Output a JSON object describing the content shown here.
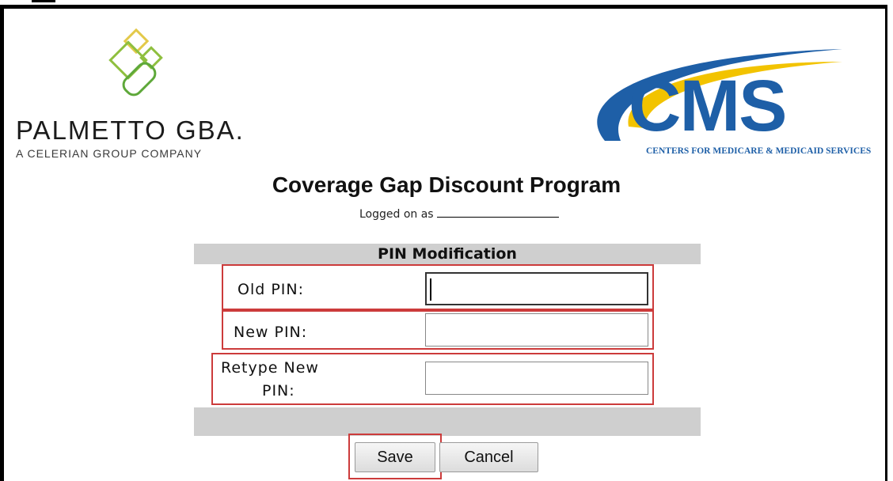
{
  "branding": {
    "palmetto_name": "PALMETTO GBA.",
    "palmetto_tagline": "A CELERIAN GROUP COMPANY",
    "cms_name": "CMS",
    "cms_tagline": "CENTERS FOR MEDICARE & MEDICAID SERVICES"
  },
  "page": {
    "title": "Coverage Gap Discount Program",
    "logged_on_label": "Logged on as"
  },
  "form": {
    "header": "PIN Modification",
    "fields": [
      {
        "label": "Old PIN:",
        "value": ""
      },
      {
        "label": "New PIN:",
        "value": ""
      },
      {
        "label_line1": "Retype New",
        "label_line2": "PIN:",
        "value": ""
      }
    ]
  },
  "buttons": {
    "save": "Save",
    "cancel": "Cancel"
  },
  "colors": {
    "highlight": "#cc3b3b",
    "panel_gray": "#cfcfcf",
    "cms_blue": "#1e5fa7",
    "cms_yellow": "#f2c300",
    "palmetto_green": "#8fbf3f"
  }
}
